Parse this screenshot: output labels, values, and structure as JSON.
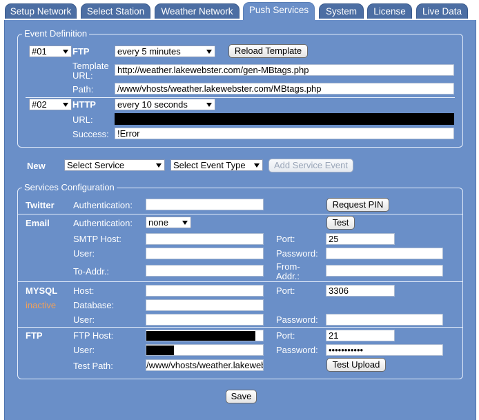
{
  "tabs": [
    "Setup Network",
    "Select Station",
    "Weather Network",
    "Push Services",
    "System",
    "License",
    "Live Data"
  ],
  "event_definition": {
    "legend": "Event Definition",
    "events": [
      {
        "number": "#01",
        "type": "FTP",
        "interval": "every 5 minutes",
        "reload_button": "Reload Template",
        "template_url_label_1": "Template",
        "template_url_label_2": "URL:",
        "template_url": "http://weather.lakewebster.com/gen-MBtags.php",
        "path_label": "Path:",
        "path": "/www/vhosts/weather.lakewebster.com/MBtags.php"
      },
      {
        "number": "#02",
        "type": "HTTP",
        "interval": "every 10 seconds",
        "url_label": "URL:",
        "url": "",
        "success_label": "Success:",
        "success": "!Error"
      }
    ]
  },
  "new_event": {
    "label": "New",
    "service_select": "Select Service",
    "event_type_select": "Select Event Type",
    "add_button": "Add Service Event"
  },
  "services": {
    "legend": "Services Configuration",
    "twitter": {
      "name": "Twitter",
      "auth_label": "Authentication:",
      "auth_value": "",
      "request_pin_button": "Request PIN"
    },
    "email": {
      "name": "Email",
      "auth_label": "Authentication:",
      "auth_value": "none",
      "test_button": "Test",
      "smtp_host_label": "SMTP Host:",
      "smtp_host": "",
      "port_label": "Port:",
      "port": "25",
      "user_label": "User:",
      "user": "",
      "password_label": "Password:",
      "password": "",
      "to_addr_label": "To-Addr.:",
      "to_addr": "",
      "from_addr_label_1": "From-",
      "from_addr_label_2": "Addr.:",
      "from_addr": ""
    },
    "mysql": {
      "name": "MYSQL",
      "status": "inactive",
      "host_label": "Host:",
      "host": "",
      "port_label": "Port:",
      "port": "3306",
      "database_label": "Database:",
      "database": "",
      "user_label": "User:",
      "user": "",
      "password_label": "Password:",
      "password": ""
    },
    "ftp": {
      "name": "FTP",
      "host_label": "FTP Host:",
      "host": "",
      "port_label": "Port:",
      "port": "21",
      "user_label": "User:",
      "user": "",
      "password_label": "Password:",
      "password": "•••••••••••",
      "test_path_label": "Test Path:",
      "test_path": "/www/vhosts/weather.lakewebster",
      "test_upload_button": "Test Upload"
    }
  },
  "save_button": "Save",
  "colors": {
    "panel": "#6a8fc8",
    "tab": "#4c6ea3",
    "inactive": "#f0a05a"
  }
}
